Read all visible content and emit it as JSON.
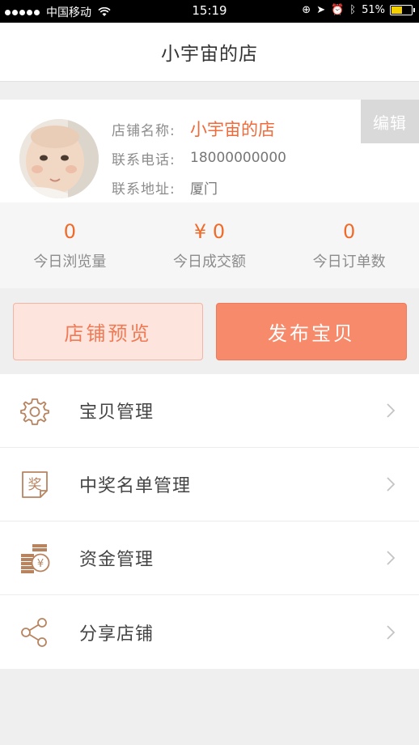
{
  "status_bar": {
    "carrier": "中国移动",
    "time": "15:19",
    "battery": "51%",
    "battery_level": 0.51
  },
  "header": {
    "title": "小宇宙的店"
  },
  "shop": {
    "edit_label": "编辑",
    "name_key": "店铺名称:",
    "name_value": "小宇宙的店",
    "phone_key": "联系电话:",
    "phone_value": "18000000000",
    "address_key": "联系地址:",
    "address_value": "厦门"
  },
  "stats": [
    {
      "value": "0",
      "label": "今日浏览量"
    },
    {
      "value": "¥ 0",
      "label": "今日成交额"
    },
    {
      "value": "0",
      "label": "今日订单数"
    }
  ],
  "actions": {
    "preview_label": "店铺预览",
    "publish_label": "发布宝贝"
  },
  "menu": [
    {
      "label": "宝贝管理",
      "icon": "gear-icon"
    },
    {
      "label": "中奖名单管理",
      "icon": "prize-icon"
    },
    {
      "label": "资金管理",
      "icon": "coins-icon"
    },
    {
      "label": "分享店铺",
      "icon": "share-icon"
    }
  ],
  "colors": {
    "accent": "#f06a2a",
    "publish_bg": "#f78a6a",
    "preview_bg": "#fde4dd",
    "icon_brown": "#b88460"
  }
}
